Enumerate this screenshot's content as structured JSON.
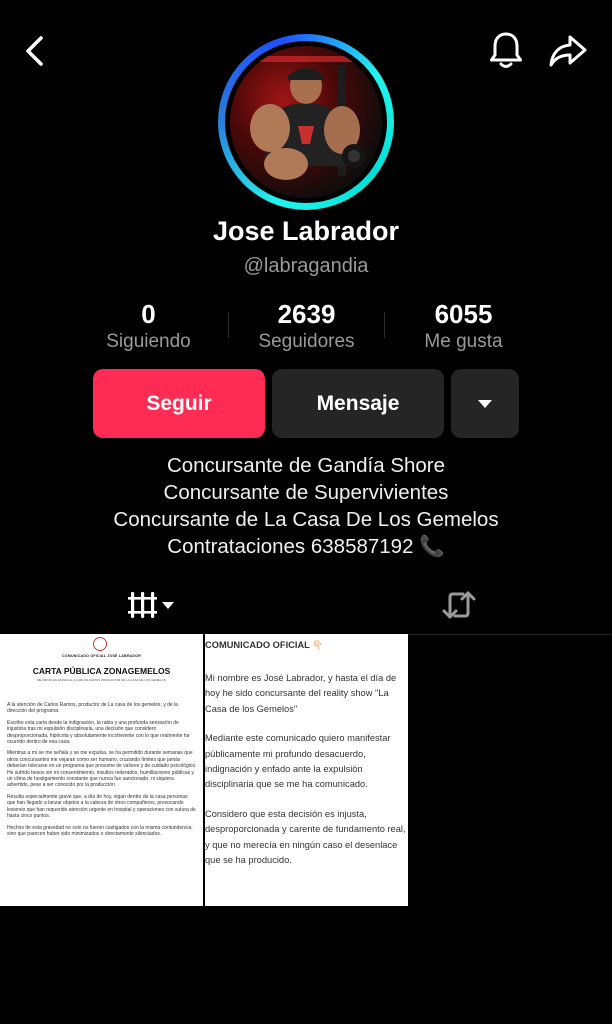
{
  "header": {
    "back_icon": "chevron-left-icon",
    "bell_icon": "bell-icon",
    "share_icon": "share-arrow-icon"
  },
  "profile": {
    "name": "Jose Labrador",
    "handle": "@labragandia",
    "ring_colors": [
      "#25f4ee",
      "#1f4fff"
    ]
  },
  "stats": [
    {
      "value": "0",
      "label": "Siguiendo"
    },
    {
      "value": "2639",
      "label": "Seguidores"
    },
    {
      "value": "6055",
      "label": "Me gusta"
    }
  ],
  "actions": {
    "follow_label": "Seguir",
    "message_label": "Mensaje",
    "more_icon": "caret-down-icon",
    "follow_color": "#fe2c55"
  },
  "bio": [
    "Concursante de Gandía Shore",
    "Concursante de Supervivientes",
    "Concursante de La Casa De Los Gemelos",
    "Contrataciones 638587192 📞"
  ],
  "tabs": [
    {
      "icon": "videos-grid-icon",
      "selected": true
    },
    {
      "icon": "repost-icon",
      "selected": false
    }
  ],
  "videos": [
    {
      "subheading": "COMUNICADO OFICIAL JOSÉ LABRADOR",
      "title": "CARTA PÚBLICA ZONAGEMELOS",
      "tagline": "ME DIRIJO EN ESPECIAL A CARLOS RAMOS PRODUCTOR DE LA CASA DE LOS GEMELOS",
      "paragraphs": [
        "A la atención de Carlos Ramos, productor de La casa de los gemelos, y de la dirección del programa:",
        "Escribo esta carta desde la indignación, la rabia y una profunda sensación de injusticia tras mi expulsión disciplinaria, una decisión que considero desproporcionada, hipócrita y absolutamente incoherente con lo que realmente ha ocurrido dentro de esa casa.",
        "Mientras a mí se me señala y se me expulsa, se ha permitido durante semanas que otros concursantes me vejaran como ser humano, cruzando límites que jamás deberían tolerarse en un programa que presume de valores y de cuidado psicológico. He sufrido besos sin mi consentimiento, insultos reiterados, humillaciones públicas y un clima de hostigamiento constante que nunca fue sancionado, ni siquiera advertido, pese a ser conocido por la producción.",
        "Resulta especialmente grave que, a día de hoy, sigan dentro de la casa personas que han llegado a lanzar objetos a la cabeza de otros compañeros, provocando lesiones que han requerido atención urgente en hospital y operaciones con sutura de hasta cinco puntos.",
        "Hechos de esta gravedad no solo no fueron castigados con la misma contundencia, sino que parecen haber sido minimizados o directamente silenciados."
      ]
    },
    {
      "heading": "COMUNICADO OFICIAL 👇🏻",
      "paragraphs": [
        "Mi nombre es José Labrador, y hasta el día de hoy he sido concursante del reality show \"La Casa de los Gemelos\"",
        "Mediante este comunicado quiero manifestar públicamente mi profundo desacuerdo, indignación y enfado ante la expulsión disciplinaria que se me ha comunicado.",
        "Considero que esta decisión es injusta, desproporcionada y carente de fundamento real, y que no merecía en ningún caso el desenlace que se ha producido."
      ]
    }
  ]
}
